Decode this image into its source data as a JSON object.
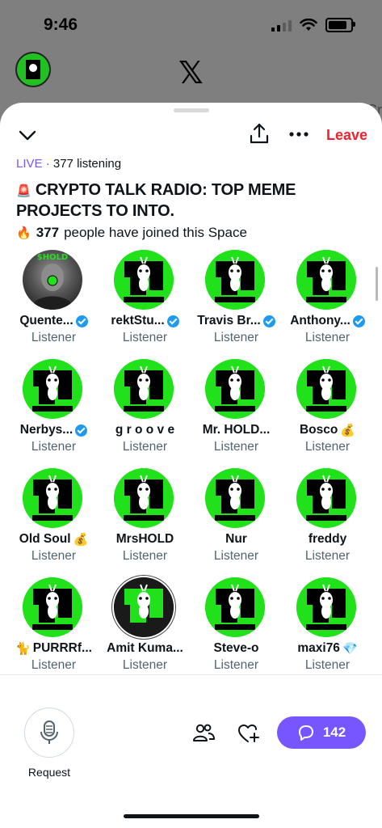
{
  "status": {
    "time": "9:46"
  },
  "background": {
    "right_text": "Cr"
  },
  "header": {
    "leave_label": "Leave"
  },
  "space": {
    "live_label": "LIVE",
    "separator": " · ",
    "listening": "377 listening",
    "siren_emoji": "🚨",
    "title": "CRYPTO TALK RADIO: TOP MEME PROJECTS TO INTO.",
    "joined_emoji": "🔥",
    "joined_count": "377",
    "joined_text": "people have joined this Space"
  },
  "participants": [
    {
      "name": "Quente...",
      "role": "Listener",
      "verified": true,
      "style": "photo",
      "badge_text": "$HOLD"
    },
    {
      "name": "rektStu...",
      "role": "Listener",
      "verified": true,
      "style": "green"
    },
    {
      "name": "Travis Br...",
      "role": "Listener",
      "verified": true,
      "style": "green"
    },
    {
      "name": "Anthony...",
      "role": "Listener",
      "verified": true,
      "style": "green"
    },
    {
      "name": "Nerbys...",
      "role": "Listener",
      "verified": true,
      "style": "green"
    },
    {
      "name": "g r o o v e",
      "role": "Listener",
      "verified": false,
      "style": "green"
    },
    {
      "name": "Mr. HOLD...",
      "role": "Listener",
      "verified": false,
      "style": "green"
    },
    {
      "name": "Bosco",
      "role": "Listener",
      "verified": false,
      "style": "green",
      "emoji": "💰"
    },
    {
      "name": "Old Soul",
      "role": "Listener",
      "verified": false,
      "style": "green",
      "emoji": "💰"
    },
    {
      "name": "MrsHOLD",
      "role": "Listener",
      "verified": false,
      "style": "green"
    },
    {
      "name": "Nur",
      "role": "Listener",
      "verified": false,
      "style": "green"
    },
    {
      "name": "freddy",
      "role": "Listener",
      "verified": false,
      "style": "green"
    },
    {
      "name": "PURRRf...",
      "role": "Listener",
      "verified": false,
      "style": "green",
      "lead_emoji": "🐈"
    },
    {
      "name": "Amit Kuma...",
      "role": "Listener",
      "verified": false,
      "style": "dark"
    },
    {
      "name": "Steve-o",
      "role": "Listener",
      "verified": false,
      "style": "green"
    },
    {
      "name": "maxi76",
      "role": "Listener",
      "verified": false,
      "style": "green",
      "emoji": "💎"
    }
  ],
  "bottom": {
    "request_label": "Request",
    "chat_count": "142"
  },
  "colors": {
    "accent": "#7856ff",
    "leave": "#f4212e",
    "avatar_green": "#21e11a",
    "verified": "#1d9bf0"
  },
  "icons": [
    "chevron-down-icon",
    "share-icon",
    "more-icon",
    "microphone-icon",
    "people-icon",
    "heart-plus-icon",
    "chat-icon",
    "fire-icon",
    "siren-icon",
    "verified-icon"
  ]
}
